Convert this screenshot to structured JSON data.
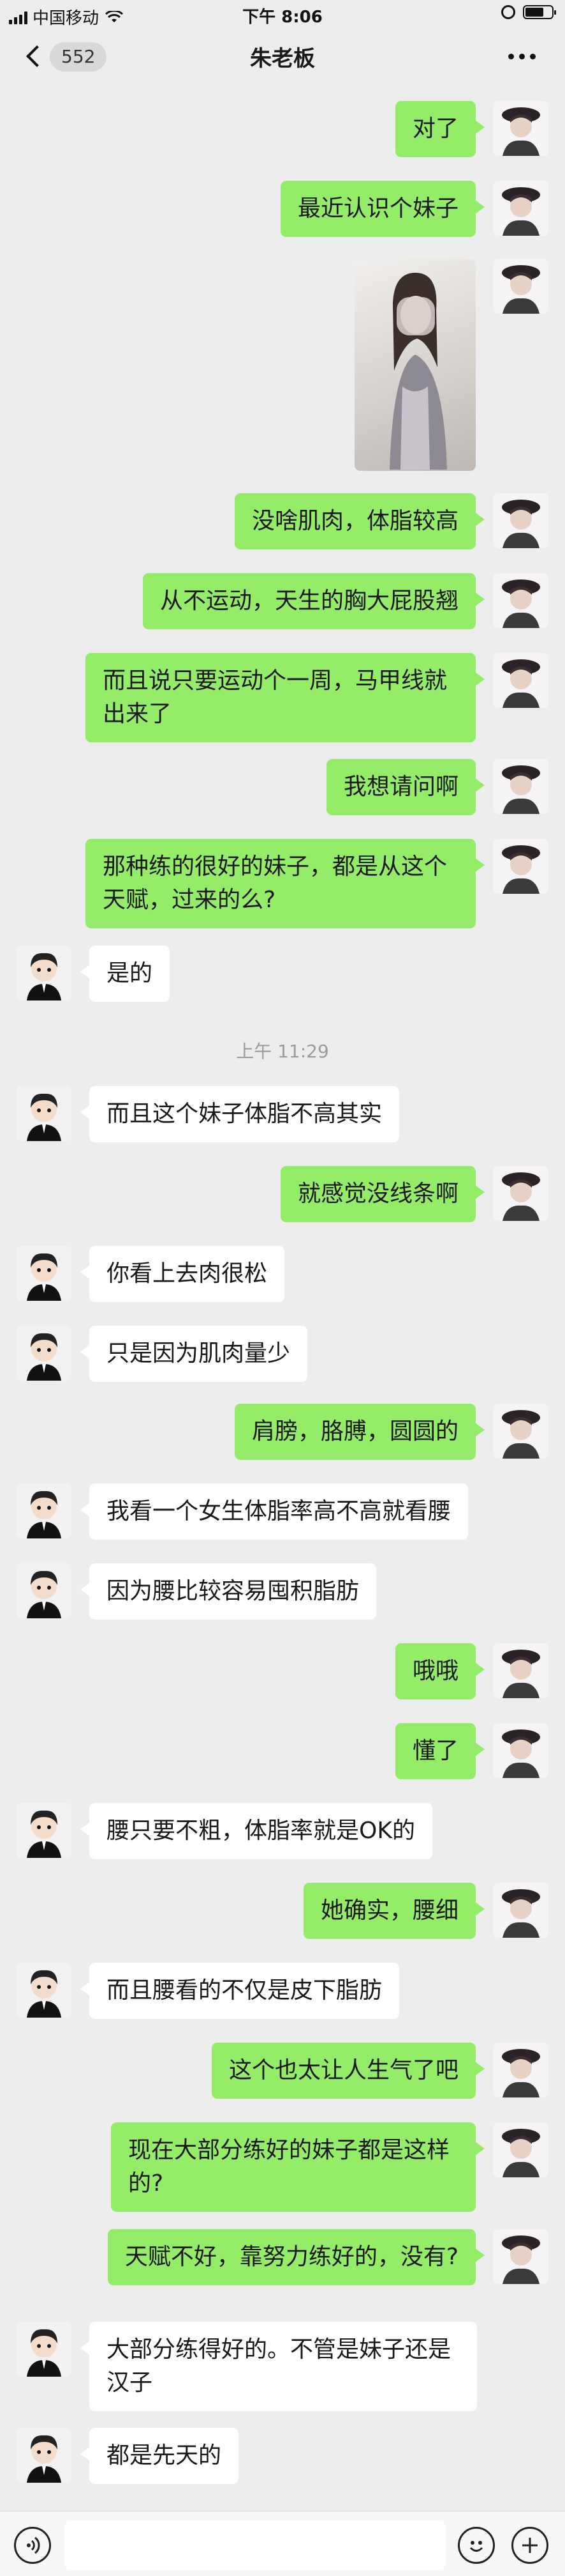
{
  "status_bar": {
    "carrier": "中国移动",
    "time": "下午 8:06"
  },
  "nav": {
    "back_count": "552",
    "title": "朱老板"
  },
  "messages": [
    {
      "side": "me",
      "text": "对了"
    },
    {
      "side": "me",
      "text": "最近认识个妹子"
    },
    {
      "side": "me",
      "type": "image"
    },
    {
      "side": "me",
      "text": "没啥肌肉，体脂较高"
    },
    {
      "side": "me",
      "text": "从不运动，天生的胸大屁股翘"
    },
    {
      "side": "me",
      "text": "而且说只要运动个一周，马甲线就出来了"
    },
    {
      "side": "me",
      "text": "我想请问啊"
    },
    {
      "side": "me",
      "text": "那种练的很好的妹子，都是从这个天赋，过来的么?"
    },
    {
      "side": "them",
      "text": "是的"
    },
    {
      "type": "timestamp",
      "text": "上午 11:29"
    },
    {
      "side": "them",
      "text": "而且这个妹子体脂不高其实"
    },
    {
      "side": "me",
      "text": "就感觉没线条啊"
    },
    {
      "side": "them",
      "text": "你看上去肉很松"
    },
    {
      "side": "them",
      "text": "只是因为肌肉量少"
    },
    {
      "side": "me",
      "text": "肩膀，胳膊，圆圆的"
    },
    {
      "side": "them",
      "text": "我看一个女生体脂率高不高就看腰"
    },
    {
      "side": "them",
      "text": "因为腰比较容易囤积脂肪"
    },
    {
      "side": "me",
      "text": "哦哦"
    },
    {
      "side": "me",
      "text": "懂了"
    },
    {
      "side": "them",
      "text": "腰只要不粗，体脂率就是OK的"
    },
    {
      "side": "me",
      "text": "她确实，腰细"
    },
    {
      "side": "them",
      "text": "而且腰看的不仅是皮下脂肪"
    },
    {
      "side": "me",
      "text": "这个也太让人生气了吧"
    },
    {
      "side": "me",
      "text": "现在大部分练好的妹子都是这样的?"
    },
    {
      "side": "me",
      "text": "天赋不好，靠努力练好的，没有?"
    },
    {
      "side": "them",
      "text": "大部分练得好的。不管是妹子还是汉子"
    },
    {
      "side": "them",
      "text": "都是先天的"
    }
  ],
  "icons": {
    "voice": "voice-icon",
    "emoji": "emoji-icon",
    "add": "add-icon"
  },
  "colors": {
    "my_bubble": "#95ec69",
    "their_bubble": "#ffffff",
    "background": "#ededed"
  }
}
